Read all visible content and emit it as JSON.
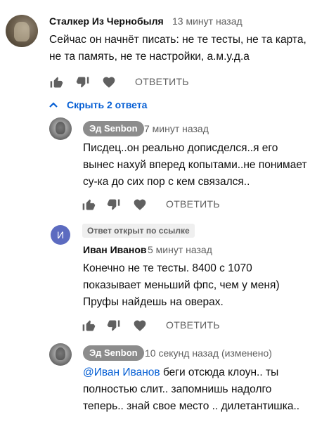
{
  "comments": [
    {
      "author": "Сталкер Из Чернобыля",
      "time": "13 минут назад",
      "lines": [
        "Сейчас он начнёт писать: не те тесты, не та карта,",
        "не та память, не те настройки, а.м.у.д.а"
      ],
      "reply_label": "ОТВЕТИТЬ"
    }
  ],
  "toggle_replies": {
    "label": "Скрыть 2 ответа"
  },
  "replies": [
    {
      "author": "Эд Senbon",
      "time": "7 минут назад",
      "lines": [
        "Писдец..он реально дописделся..я его",
        "вынес нахуй вперед копытами..не понимает",
        "су-ка до сих пор с кем связался.."
      ],
      "reply_label": "ОТВЕТИТЬ"
    },
    {
      "avatar_letter": "И",
      "pinned_note": "Ответ открыт по ссылке",
      "author": "Иван Иванов",
      "time": "5 минут назад",
      "lines": [
        "Конечно не те тесты. 8400 с 1070",
        "показывает меньший фпс, чем у меня)",
        "Пруфы найдешь на оверах."
      ],
      "reply_label": "ОТВЕТИТЬ"
    },
    {
      "author": "Эд Senbon",
      "time": "10 секунд назад (изменено)",
      "mention": "@Иван Иванов",
      "line1_rest": " беги отсюда клоун.. ты",
      "lines": [
        "полностью слит.. запомнишь надолго",
        "теперь.. знай свое место .. дилетантишка.."
      ]
    }
  ],
  "colors": {
    "link": "#065fd4",
    "secondary_text": "#606060",
    "chip_bg": "#8c8c8c",
    "avatar_letter_bg": "#5c6bc0"
  },
  "icons": [
    "like-icon",
    "dislike-icon",
    "heart-icon",
    "chevron-up-icon"
  ]
}
